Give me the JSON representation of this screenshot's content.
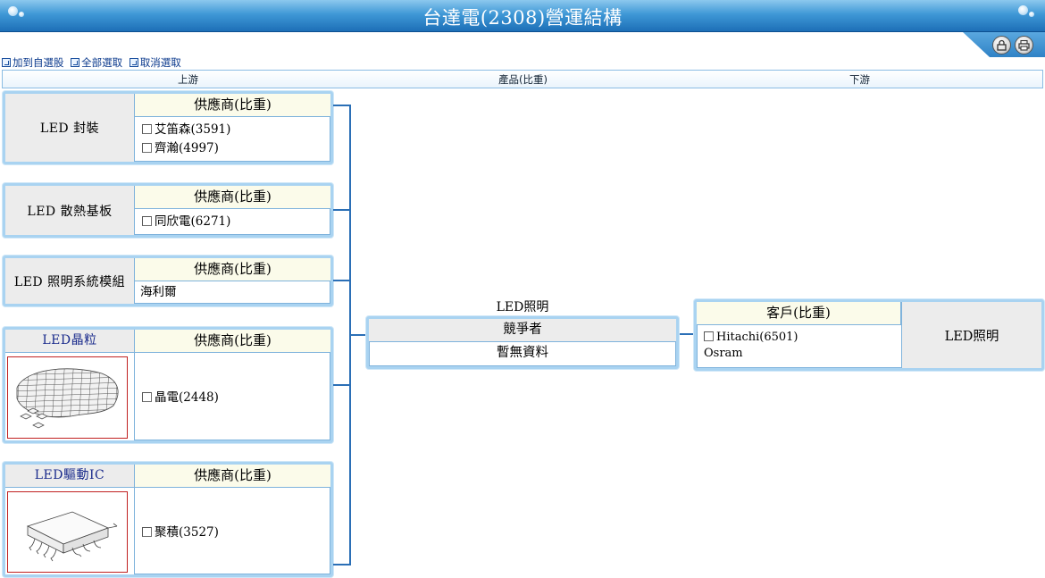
{
  "header": {
    "title": "台達電(2308)營運結構"
  },
  "toolbar": {
    "lock_icon": "lock-icon",
    "print_icon": "printer-icon",
    "actions": [
      {
        "label": "加到自選股"
      },
      {
        "label": "全部選取"
      },
      {
        "label": "取消選取"
      }
    ]
  },
  "columns": {
    "upstream": "上游",
    "product": "產品(比重)",
    "downstream": "下游"
  },
  "upstream": [
    {
      "category": "LED 封裝",
      "supplier_header": "供應商(比重)",
      "items": [
        {
          "label": "艾笛森(3591)",
          "checkbox": true
        },
        {
          "label": "齊瀚(4997)",
          "checkbox": true
        }
      ]
    },
    {
      "category": "LED 散熱基板",
      "supplier_header": "供應商(比重)",
      "items": [
        {
          "label": "同欣電(6271)",
          "checkbox": true
        }
      ]
    },
    {
      "category": "LED 照明系統模組",
      "supplier_header": "供應商(比重)",
      "items": [
        {
          "label": "海利爾",
          "checkbox": false
        }
      ]
    },
    {
      "category": "LED晶粒",
      "supplier_header": "供應商(比重)",
      "image": "led-wafer-image",
      "items": [
        {
          "label": "晶電(2448)",
          "checkbox": true
        }
      ]
    },
    {
      "category": "LED驅動IC",
      "supplier_header": "供應商(比重)",
      "image": "ic-chip-image",
      "items": [
        {
          "label": "聚積(3527)",
          "checkbox": true
        }
      ]
    }
  ],
  "product": {
    "name": "LED照明",
    "competitor_header": "競爭者",
    "competitor_value": "暫無資料"
  },
  "downstream": {
    "customer_header": "客戶(比重)",
    "customers": [
      {
        "label": "Hitachi(6501)",
        "checkbox": true
      },
      {
        "label": "Osram",
        "checkbox": false
      }
    ],
    "product": "LED照明"
  },
  "colors": {
    "title_bar": "#1d6fb7",
    "box_border": "#a9d3f1",
    "connector": "#2b6fb6",
    "image_border": "#c02020"
  }
}
